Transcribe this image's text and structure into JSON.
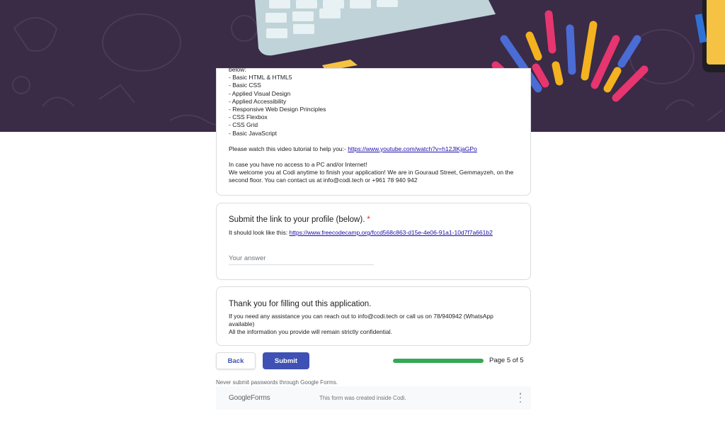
{
  "description": {
    "lines": [
      "below:",
      "- Basic HTML & HTML5",
      "- Basic CSS",
      "- Applied Visual Design",
      "- Applied Accessibility",
      "- Responsive Web Design Principles",
      "- CSS Flexbox",
      "- CSS Grid",
      "- Basic JavaScript"
    ],
    "video_prefix": "Please watch this video tutorial to help you:- ",
    "video_link": "https://www.youtube.com/watch?v=h12JlKjaGPo",
    "no_access": "In case you have no access to a PC and/or Internet!",
    "welcome_1": "We welcome you at Codi anytime to finish your application! We are in Gouraud Street, Gemmayzeh, on the",
    "welcome_2": "second floor. You can contact us at info@codi.tech or +961 78 940 942"
  },
  "question": {
    "title": "Submit the link to your profile (below).",
    "required_mark": "*",
    "help_prefix": "It should look like this: ",
    "help_link": "https://www.freecodecamp.org/fccd568c863-d15e-4e06-91a1-10d7f7a661b2",
    "answer_placeholder": "Your answer",
    "answer_value": ""
  },
  "thanks": {
    "title": "Thank you for filling out this application.",
    "line_1": "If you need any assistance you can reach out to info@codi.tech or call us on 78/940942 (WhatsApp",
    "line_2": "available)",
    "line_3": "All the information you provide will remain strictly confidential."
  },
  "nav": {
    "back_label": "Back",
    "submit_label": "Submit",
    "progress": 1.0,
    "page_indicator": "Page 5 of 5"
  },
  "footer": {
    "warning": "Never submit passwords through Google Forms.",
    "brand_google": "Google",
    "brand_forms": "Forms",
    "note": "This form was created inside Codi."
  },
  "colors": {
    "banner_bg": "#3a2b47",
    "accent": "#3f51b5",
    "progress": "#34a853",
    "required": "#d93025",
    "link": "#1a0dab"
  },
  "icons": {
    "menu": "more-vert-icon"
  }
}
